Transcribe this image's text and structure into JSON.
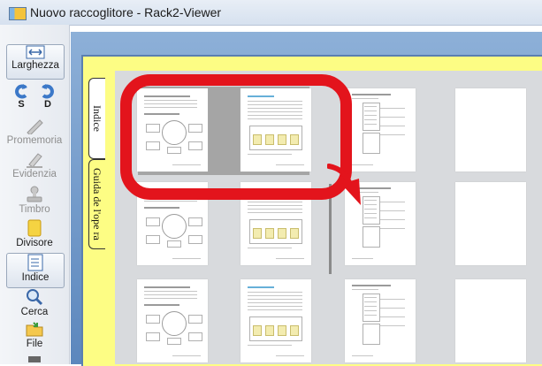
{
  "window": {
    "title": "Nuovo raccoglitore - Rack2-Viewer"
  },
  "toolbar": {
    "larghezza": "Larghezza",
    "rotate_s": "S",
    "rotate_d": "D",
    "promemoria": "Promemoria",
    "evidenzia": "Evidenzia",
    "timbro": "Timbro",
    "divisore": "Divisore",
    "indice": "Indice",
    "cerca": "Cerca",
    "file": "File"
  },
  "tabs": {
    "indice": "Indice",
    "guida": "Guida de l'ope ra"
  },
  "colors": {
    "annotation": "#e3141c",
    "binder_yellow": "#fdfd84",
    "frame_blue": "#5c87bd"
  }
}
